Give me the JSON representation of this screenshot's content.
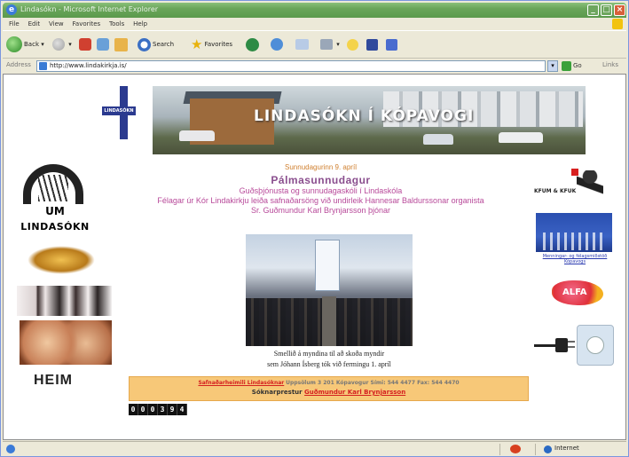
{
  "window": {
    "title": "Lindasókn - Microsoft Internet Explorer"
  },
  "menu": [
    "File",
    "Edit",
    "View",
    "Favorites",
    "Tools",
    "Help"
  ],
  "toolbar": {
    "back": "Back",
    "search": "Search",
    "favorites": "Favorites"
  },
  "address": {
    "label": "Address",
    "url": "http://www.lindakirkja.is/",
    "go": "Go",
    "links": "Links"
  },
  "banner": {
    "text": "LINDASÓKN Í KÓPAVOGI",
    "cross_text": "LINDASÓKN"
  },
  "left": {
    "logo_um": "UM",
    "logo_name": "LINDASÓKN",
    "heim": "HEIM"
  },
  "center": {
    "date": "Sunnudagurinn 9. apríl",
    "title": "Pálmasunnudagur",
    "lines": [
      "Guðsþjónusta og sunnudagaskóli í Lindaskóla",
      "Félagar úr Kór Lindakirkju leiða safnaðarsöng við undirleik Hannesar Baldurssonar organista",
      "Sr. Guðmundur Karl Brynjarsson þjónar"
    ],
    "caption_1": "Smellið á myndina til að skoða myndir",
    "caption_2": "sem Jóhann Ísberg tók við fermingu 1. apríl"
  },
  "footer": {
    "office_label": "Safnaðarheimili Lindasóknar",
    "office_info": "Uppsölum 3 201 Kópavogur Sími: 544 4477 Fax: 544 4470",
    "priest_label": "Sóknarprestur",
    "priest_name": "Guðmundur Karl Brynjarsson"
  },
  "counter": "000394",
  "right": {
    "boatman_text": "KFUM & KFUK",
    "city_caption": "Menningar- og félagsmiðstöð Kópavogs",
    "alfa_text": "ALFA"
  },
  "status": {
    "zone": "Internet"
  }
}
